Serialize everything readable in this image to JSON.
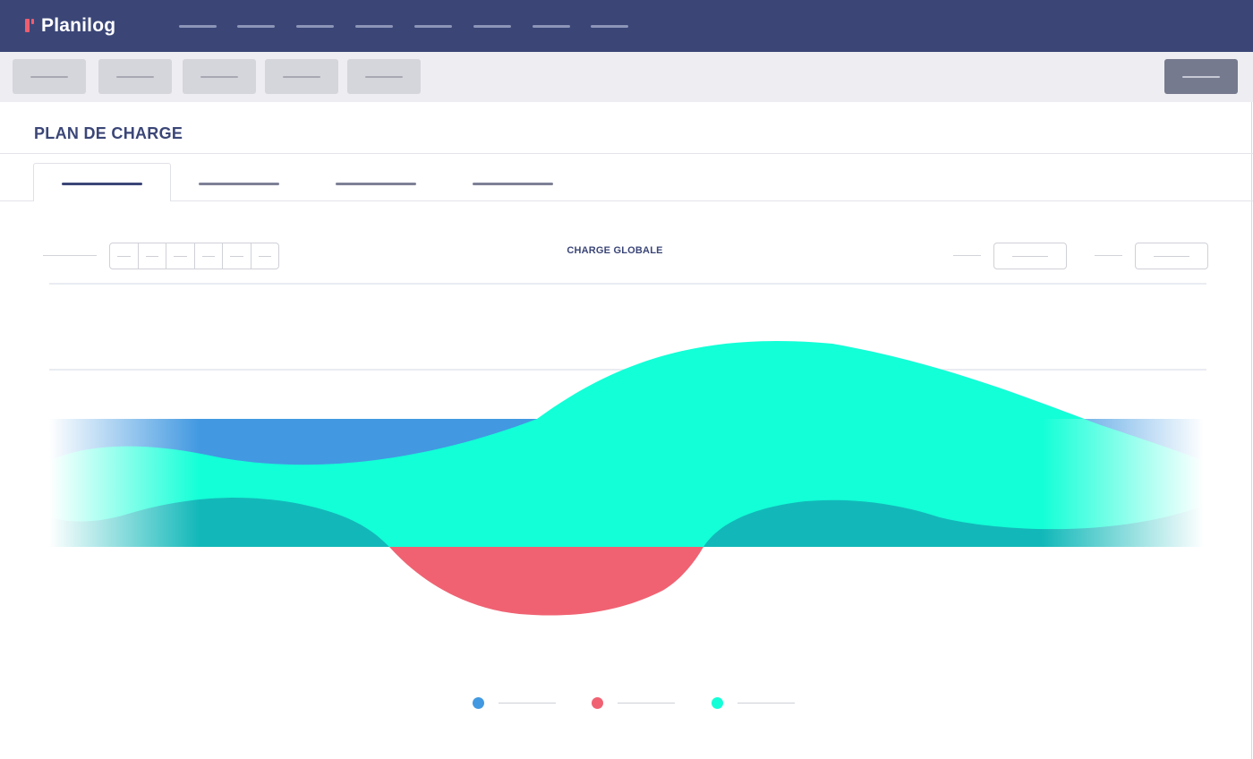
{
  "app": {
    "name": "Planilog"
  },
  "page": {
    "title": "PLAN DE CHARGE"
  },
  "chart_data": {
    "type": "area",
    "title": "CHARGE GLOBALE",
    "xlabel": "",
    "ylabel": "",
    "grid": true,
    "legend": "bottom-center",
    "x": [
      0,
      1,
      2,
      3,
      4,
      5,
      6,
      7,
      8,
      9,
      10,
      11,
      12
    ],
    "series": [
      {
        "color": "#4299e1",
        "values": [
          0.6,
          0.6,
          0.6,
          0.6,
          0.6,
          0.6,
          0.6,
          0.6,
          0.6,
          0.6,
          0.6,
          0.6,
          0.6
        ]
      },
      {
        "color": "#f06272",
        "values": [
          0,
          0,
          0,
          0,
          -0.35,
          -0.8,
          -0.78,
          -0.2,
          0,
          0,
          0,
          0,
          0
        ]
      },
      {
        "color": "#13ffd7",
        "values": [
          0.4,
          0.5,
          0.35,
          0.45,
          0.55,
          1.1,
          1.75,
          2.25,
          2.1,
          1.7,
          1.3,
          0.9,
          0.45
        ]
      }
    ],
    "colors": {
      "blue": "#4299e1",
      "red": "#f06272",
      "teal": "#13ffd7",
      "overlap": "#12b8b9"
    }
  },
  "theme": {
    "navbar": "#3b4677",
    "accent": "#ef5d6e"
  }
}
